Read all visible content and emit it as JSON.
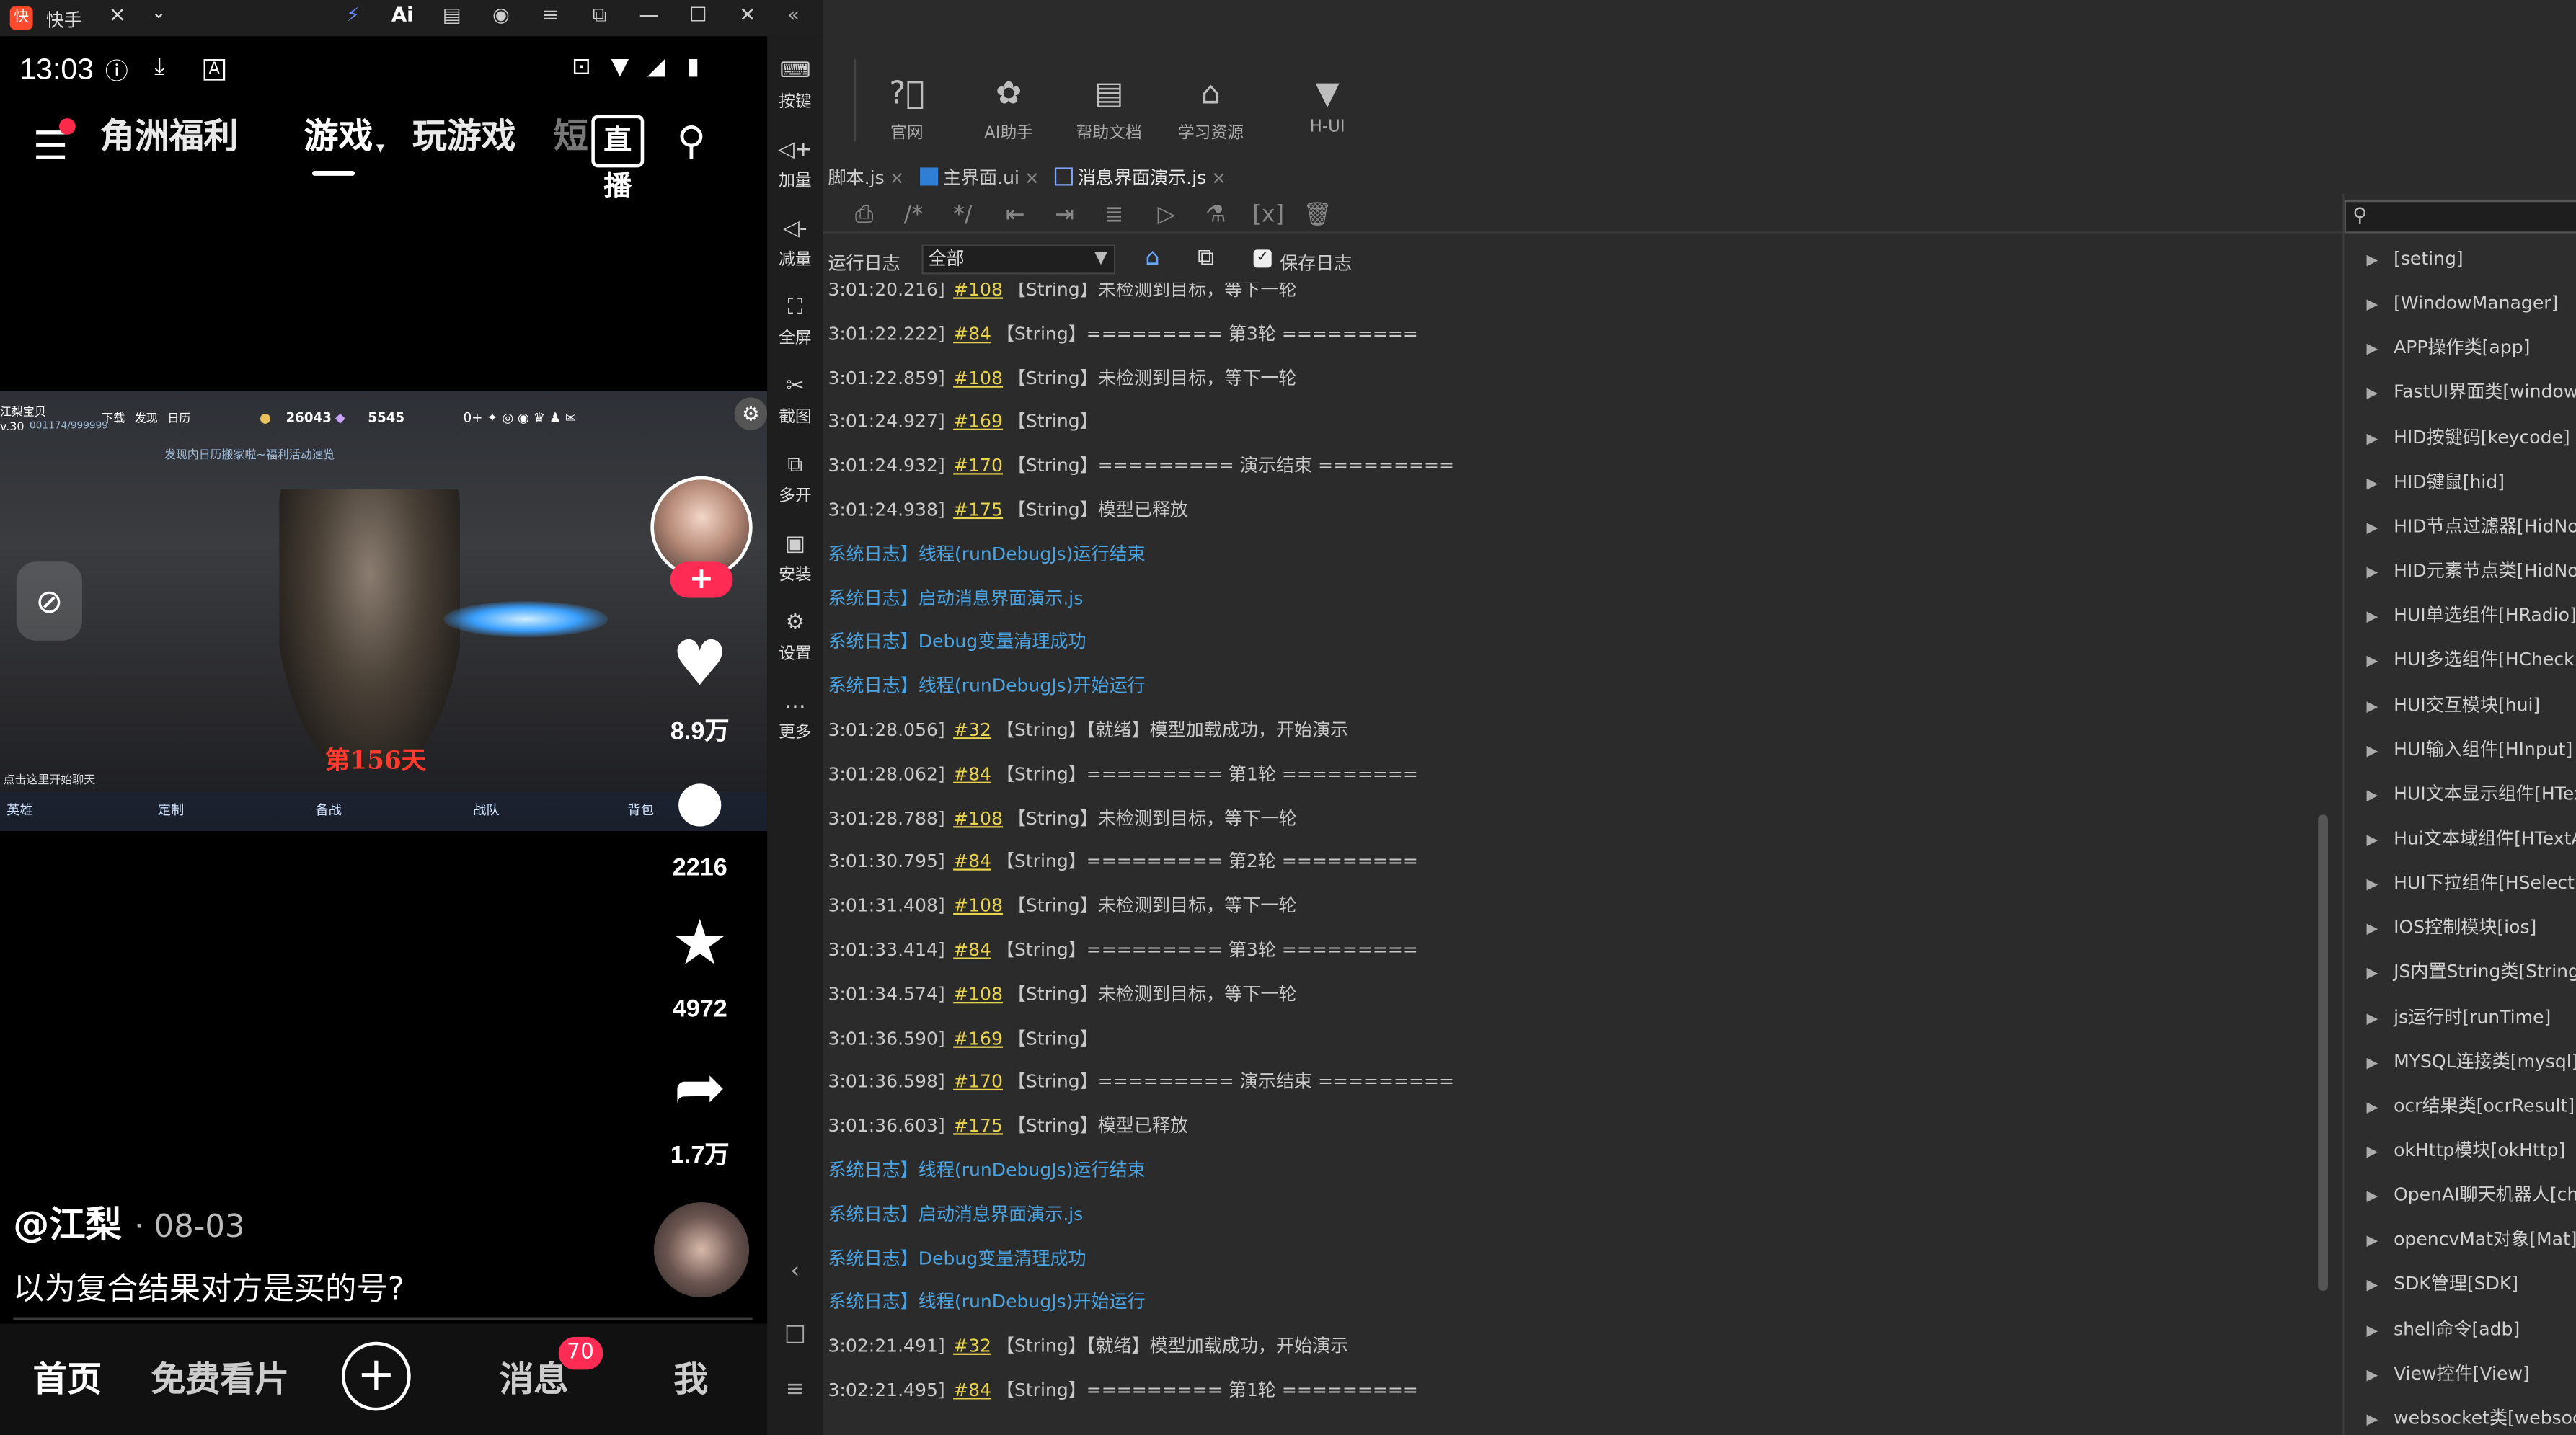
{
  "mirror": {
    "app_title": "快手",
    "title_icons": [
      "lightning-icon",
      "ai-icon",
      "store-icon",
      "user-icon",
      "menu-icon",
      "screen-icon",
      "minimize-icon",
      "maximize-icon",
      "close-icon"
    ]
  },
  "status_bar": {
    "time": "13:03"
  },
  "top_nav": {
    "tabs": [
      "角洲福利",
      "游戏",
      "玩游戏",
      "短"
    ],
    "active_tab": "游戏",
    "live_label": "直播"
  },
  "game_hud": {
    "player_name": "江梨宝贝",
    "player_level": "v.30",
    "player_id": "001174/999999",
    "hud_labels": [
      "下载",
      "发现",
      "日历"
    ],
    "currency_1": "26043",
    "currency_2": "5545",
    "notice": "发现内日历搬家啦~福利活动速览",
    "day_text": "第156天",
    "chat_hint": "点击这里开始聊天",
    "bottom_menu": [
      "英雄",
      "定制",
      "备战",
      "战队",
      "背包"
    ]
  },
  "side_actions": {
    "likes": "8.9万",
    "comments": "2216",
    "favorites": "4972",
    "shares": "1.7万"
  },
  "post": {
    "author": "@江梨",
    "date": "· 08-03",
    "caption": "以为复合结果对方是买的号?"
  },
  "bottom_nav": {
    "home": "首页",
    "free": "免费看片",
    "messages": "消息",
    "messages_badge": "70",
    "me": "我"
  },
  "side_tools": [
    {
      "label": "按键",
      "icon": "keyboard-icon"
    },
    {
      "label": "加量",
      "icon": "volume-up-icon"
    },
    {
      "label": "减量",
      "icon": "volume-down-icon"
    },
    {
      "label": "全屏",
      "icon": "fullscreen-icon"
    },
    {
      "label": "截图",
      "icon": "scissors-icon"
    },
    {
      "label": "多开",
      "icon": "multi-window-icon"
    },
    {
      "label": "安装",
      "icon": "apk-icon"
    },
    {
      "label": "设置",
      "icon": "gear-icon"
    },
    {
      "label": "更多",
      "icon": "more-icon"
    }
  ],
  "ide_toolbar": [
    {
      "label": "官网",
      "icon": "question-icon"
    },
    {
      "label": "AI助手",
      "icon": "openai-icon"
    },
    {
      "label": "帮助文档",
      "icon": "document-icon"
    },
    {
      "label": "学习资源",
      "icon": "graduation-cap-icon"
    },
    {
      "label": "H-UI",
      "icon": "vue-icon"
    }
  ],
  "editor_tabs": [
    {
      "label": "脚本.js",
      "active": false
    },
    {
      "label": "主界面.ui",
      "active": false
    },
    {
      "label": "消息界面演示.js",
      "active": true
    }
  ],
  "log_bar": {
    "label": "运行日志",
    "filter_value": "全部",
    "save_log_label": "保存日志",
    "save_log_checked": true
  },
  "log_lines": [
    {
      "time": "3:01:20.216]",
      "num": "#108",
      "text": "【String】未检测到目标，等下一轮",
      "sys": false
    },
    {
      "time": "3:01:22.222]",
      "num": "#84",
      "text": "【String】========= 第3轮 =========",
      "sys": false
    },
    {
      "time": "3:01:22.859]",
      "num": "#108",
      "text": "【String】未检测到目标，等下一轮",
      "sys": false
    },
    {
      "time": "3:01:24.927]",
      "num": "#169",
      "text": "【String】",
      "sys": false
    },
    {
      "time": "3:01:24.932]",
      "num": "#170",
      "text": "【String】========= 演示结束 =========",
      "sys": false
    },
    {
      "time": "3:01:24.938]",
      "num": "#175",
      "text": "【String】模型已释放",
      "sys": false
    },
    {
      "time": "",
      "num": "",
      "text": "系统日志】线程(runDebugJs)运行结束",
      "sys": true
    },
    {
      "time": "",
      "num": "",
      "text": "系统日志】启动消息界面演示.js",
      "sys": true
    },
    {
      "time": "",
      "num": "",
      "text": "系统日志】Debug变量清理成功",
      "sys": true
    },
    {
      "time": "",
      "num": "",
      "text": "系统日志】线程(runDebugJs)开始运行",
      "sys": true
    },
    {
      "time": "3:01:28.056]",
      "num": "#32",
      "text": "【String】【就绪】模型加载成功，开始演示",
      "sys": false
    },
    {
      "time": "3:01:28.062]",
      "num": "#84",
      "text": "【String】========= 第1轮 =========",
      "sys": false
    },
    {
      "time": "3:01:28.788]",
      "num": "#108",
      "text": "【String】未检测到目标，等下一轮",
      "sys": false
    },
    {
      "time": "3:01:30.795]",
      "num": "#84",
      "text": "【String】========= 第2轮 =========",
      "sys": false
    },
    {
      "time": "3:01:31.408]",
      "num": "#108",
      "text": "【String】未检测到目标，等下一轮",
      "sys": false
    },
    {
      "time": "3:01:33.414]",
      "num": "#84",
      "text": "【String】========= 第3轮 =========",
      "sys": false
    },
    {
      "time": "3:01:34.574]",
      "num": "#108",
      "text": "【String】未检测到目标，等下一轮",
      "sys": false
    },
    {
      "time": "3:01:36.590]",
      "num": "#169",
      "text": "【String】",
      "sys": false
    },
    {
      "time": "3:01:36.598]",
      "num": "#170",
      "text": "【String】========= 演示结束 =========",
      "sys": false
    },
    {
      "time": "3:01:36.603]",
      "num": "#175",
      "text": "【String】模型已释放",
      "sys": false
    },
    {
      "time": "",
      "num": "",
      "text": "系统日志】线程(runDebugJs)运行结束",
      "sys": true
    },
    {
      "time": "",
      "num": "",
      "text": "系统日志】启动消息界面演示.js",
      "sys": true
    },
    {
      "time": "",
      "num": "",
      "text": "系统日志】Debug变量清理成功",
      "sys": true
    },
    {
      "time": "",
      "num": "",
      "text": "系统日志】线程(runDebugJs)开始运行",
      "sys": true
    },
    {
      "time": "3:02:21.491]",
      "num": "#32",
      "text": "【String】【就绪】模型加载成功，开始演示",
      "sys": false
    },
    {
      "time": "3:02:21.495]",
      "num": "#84",
      "text": "【String】========= 第1轮 =========",
      "sys": false
    }
  ],
  "api_tree": [
    "[seting]",
    "[WindowManager]",
    "APP操作类[app]",
    "FastUI界面类[window]",
    "HID按键码[keycode]",
    "HID键鼠[hid]",
    "HID节点过滤器[HidNode",
    "HID元素节点类[HidNode",
    "HUI单选组件[HRadio]",
    "HUI多选组件[HCheck]",
    "HUI交互模块[hui]",
    "HUI输入组件[HInput]",
    "HUI文本显示组件[HText",
    "Hui文本域组件[HTextAr",
    "HUI下拉组件[HSelect]",
    "IOS控制模块[ios]",
    "JS内置String类[String]",
    "js运行时[runTime]",
    "MYSQL连接类[mysql]",
    "ocr结果类[ocrResult]",
    "okHttp模块[okHttp]",
    "OpenAI聊天机器人[chat",
    "opencvMat对象[Mat]",
    "SDK管理[SDK]",
    "shell命令[adb]",
    "View控件[View]",
    "websocket类[websocke"
  ]
}
